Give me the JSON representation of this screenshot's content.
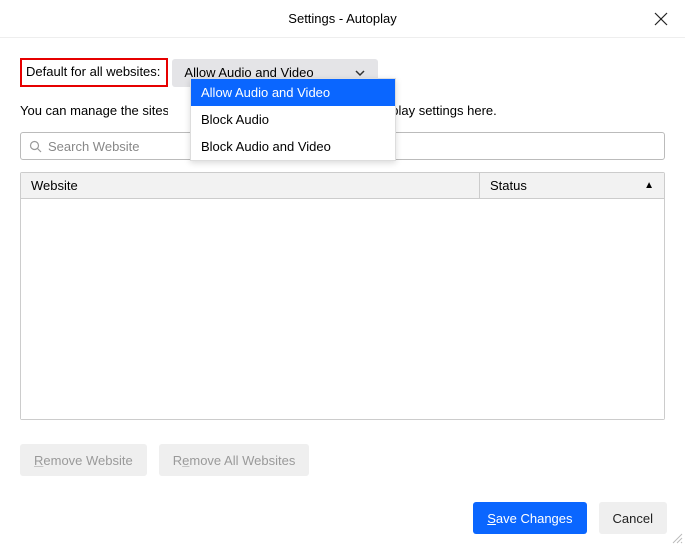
{
  "title": "Settings - Autoplay",
  "default_label": "Default for all websites:",
  "dropdown": {
    "value": "Allow Audio and Video",
    "options": [
      "Allow Audio and Video",
      "Block Audio",
      "Block Audio and Video"
    ],
    "selected_index": 0
  },
  "manage_text": {
    "left": "You can manage the sites",
    "right": "oplay settings here."
  },
  "search": {
    "placeholder": "Search Website"
  },
  "table": {
    "headers": {
      "website": "Website",
      "status": "Status"
    },
    "rows": []
  },
  "buttons": {
    "remove_website": "Remove Website",
    "remove_all": "Remove All Websites",
    "save": "Save Changes",
    "cancel": "Cancel"
  }
}
